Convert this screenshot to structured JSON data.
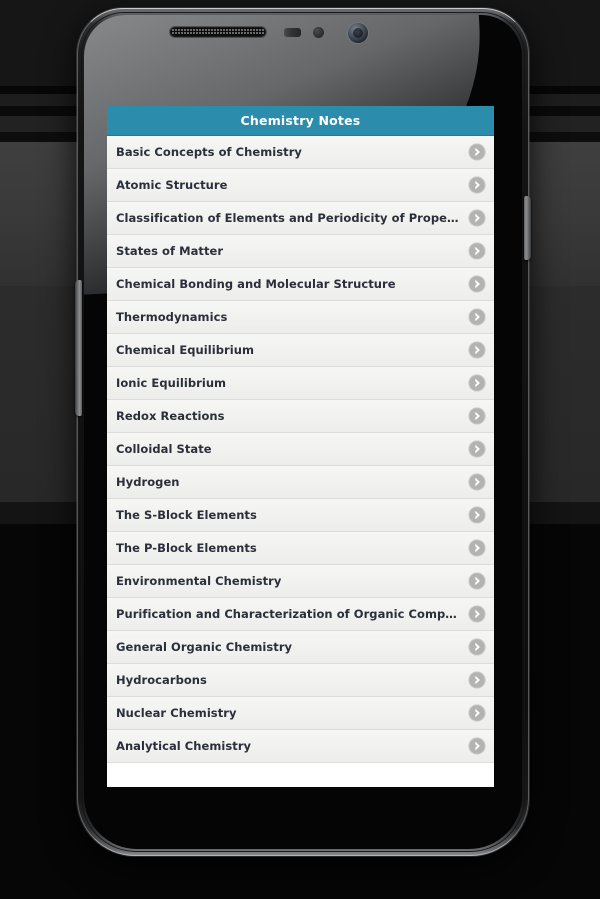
{
  "app": {
    "header": {
      "title": "Chemistry Notes",
      "background_color": "#2b8cab",
      "text_color": "#ffffff"
    },
    "list": {
      "row_background": "#f2f2f0",
      "row_text_color": "#2a2f3a",
      "separator_color": "#dcdcda",
      "chevron_icon": "chevron-right-circle-icon",
      "chevron_circle_color": "#b3b3b3",
      "chevron_glyph_color": "#ffffff",
      "items": [
        {
          "label": "Basic Concepts of Chemistry"
        },
        {
          "label": "Atomic Structure"
        },
        {
          "label": "Classification of Elements and Periodicity of Properties"
        },
        {
          "label": "States of Matter"
        },
        {
          "label": "Chemical Bonding and Molecular Structure"
        },
        {
          "label": "Thermodynamics"
        },
        {
          "label": "Chemical Equilibrium"
        },
        {
          "label": "Ionic Equilibrium"
        },
        {
          "label": "Redox Reactions"
        },
        {
          "label": "Colloidal State"
        },
        {
          "label": "Hydrogen"
        },
        {
          "label": "The S-Block Elements"
        },
        {
          "label": "The P-Block Elements"
        },
        {
          "label": "Environmental Chemistry"
        },
        {
          "label": "Purification and Characterization of Organic Compounds"
        },
        {
          "label": "General Organic Chemistry"
        },
        {
          "label": "Hydrocarbons"
        },
        {
          "label": "Nuclear Chemistry"
        },
        {
          "label": "Analytical Chemistry"
        }
      ]
    }
  },
  "device": {
    "type": "smartphone",
    "body_color": "#0e0e0e",
    "bezel_color": "#121212",
    "hardware": [
      {
        "name": "earpiece-speaker"
      },
      {
        "name": "proximity-sensor"
      },
      {
        "name": "light-sensor"
      },
      {
        "name": "front-camera"
      },
      {
        "name": "power-button"
      },
      {
        "name": "volume-button"
      }
    ]
  },
  "background": {
    "base_color": "#000000",
    "band_color": "#3a3a3a"
  }
}
